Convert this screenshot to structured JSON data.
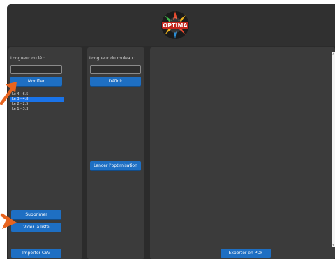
{
  "colors": {
    "window_bg": "#2b2b2b",
    "panel_bg": "#3b3b3b",
    "button": "#1e6fc3",
    "selection": "#1a73e8",
    "annotation_arrow": "#e8641e"
  },
  "header": {
    "logo_text": "OPTIMA",
    "logo_icon": "optima-logo"
  },
  "left_panel": {
    "length_label": "Longueur du lé :",
    "length_value": "",
    "modify_button": "Modifier",
    "items": [
      {
        "label": "Lé 4 - 6.5",
        "selected": false
      },
      {
        "label": "Lé 3 - 4.8",
        "selected": true
      },
      {
        "label": "Lé 2 - 2.5",
        "selected": false
      },
      {
        "label": "Lé 1 - 3.3",
        "selected": false
      }
    ],
    "delete_button": "Supprimer",
    "clear_button": "Vider la liste",
    "import_button": "Importer CSV"
  },
  "middle_panel": {
    "roll_label": "Longueur du rouleau :",
    "roll_value": "",
    "define_button": "Définir",
    "optimize_button": "Lancer l'optimisation"
  },
  "right_panel": {
    "export_button": "Exporter en PDF"
  }
}
